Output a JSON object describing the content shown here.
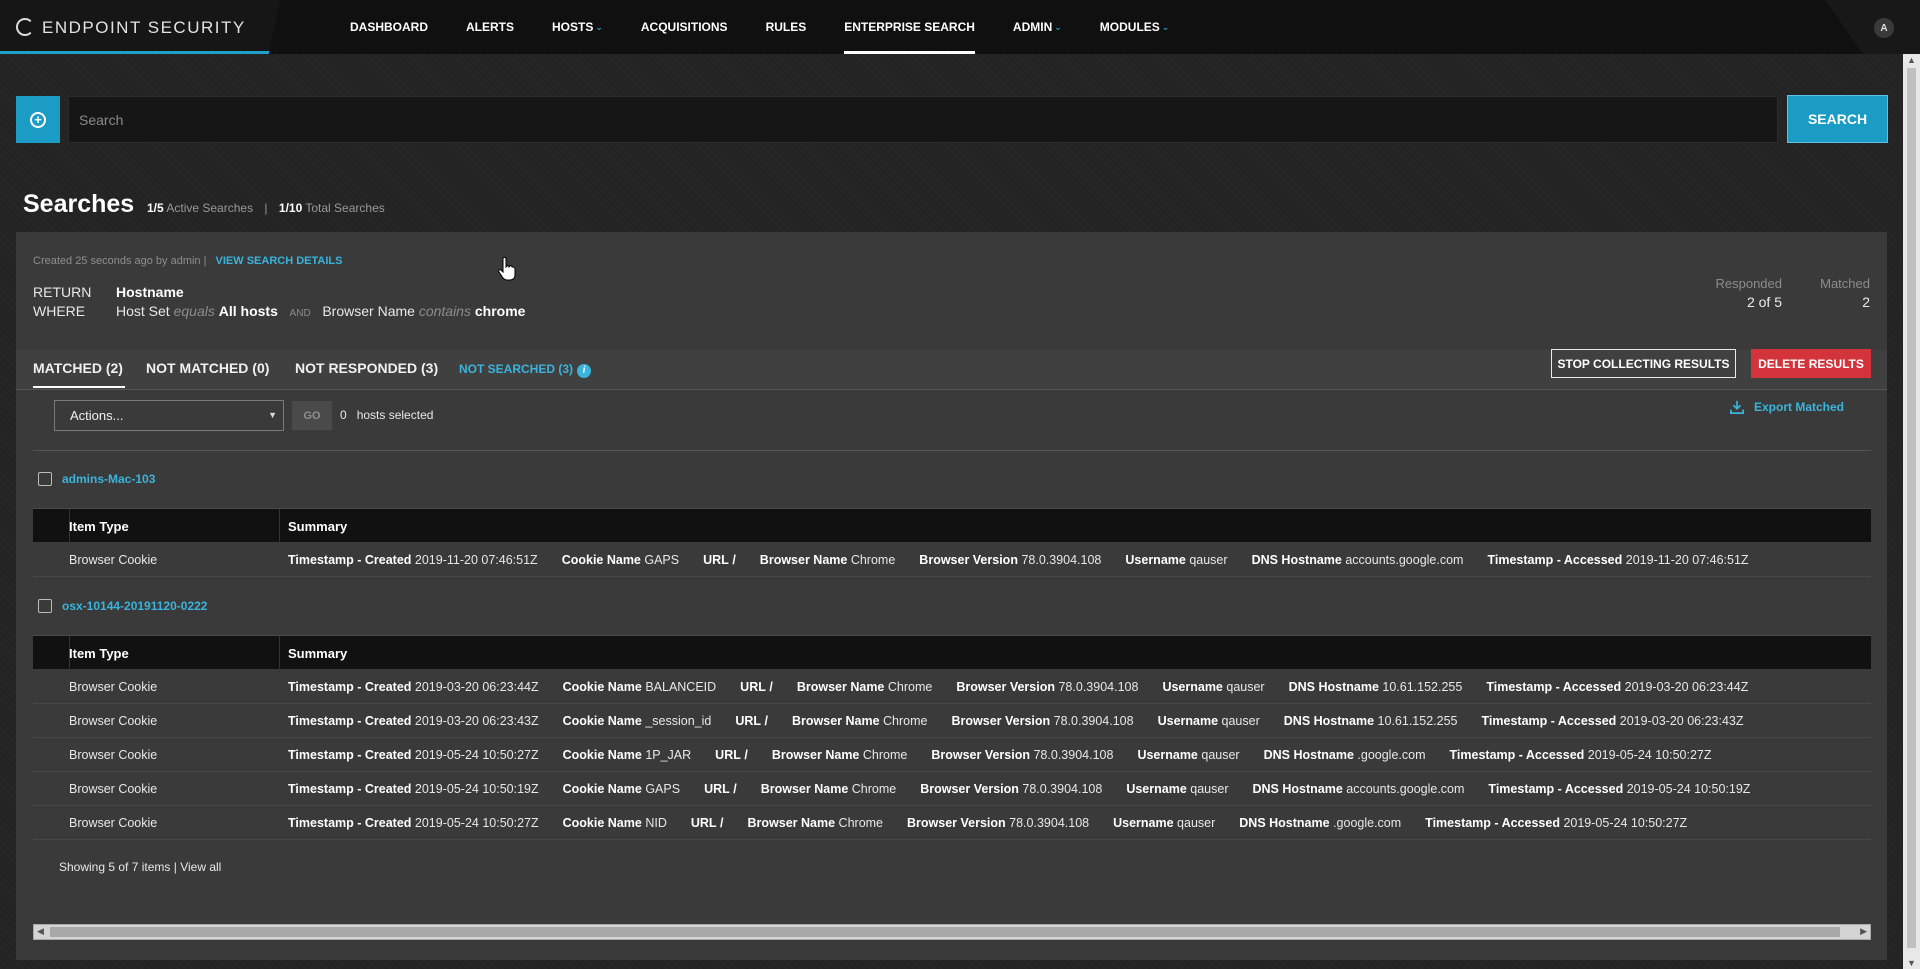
{
  "brand": {
    "title": "ENDPOINT SECURITY"
  },
  "nav": {
    "items": [
      {
        "label": "DASHBOARD"
      },
      {
        "label": "ALERTS"
      },
      {
        "label": "HOSTS",
        "caret": "⌄"
      },
      {
        "label": "ACQUISITIONS"
      },
      {
        "label": "RULES"
      },
      {
        "label": "ENTERPRISE SEARCH"
      },
      {
        "label": "ADMIN",
        "caret": "⌄"
      },
      {
        "label": "MODULES",
        "caret": "⌄"
      }
    ],
    "active": "ENTERPRISE SEARCH"
  },
  "user": {
    "initial": "A"
  },
  "search": {
    "placeholder": "Search",
    "button_label": "SEARCH"
  },
  "page": {
    "title": "Searches",
    "active_count": "1/5",
    "active_label": "Active Searches",
    "sep": "|",
    "total_count": "1/10",
    "total_label": "Total Searches"
  },
  "search_detail": {
    "created": "Created 25 seconds ago by admin  |",
    "view_details": "VIEW SEARCH DETAILS",
    "return_label": "RETURN",
    "return_value": "Hostname",
    "where_label": "WHERE",
    "cond1_field": "Host Set",
    "cond1_op": "equals",
    "cond1_value": "All hosts",
    "and_label": "AND",
    "cond2_field": "Browser Name",
    "cond2_op": "contains",
    "cond2_value": "chrome",
    "responded_label": "Responded",
    "responded_value": "2 of 5",
    "matched_label": "Matched",
    "matched_value": "2"
  },
  "tabs": {
    "matched": "MATCHED (2)",
    "not_matched": "NOT MATCHED (0)",
    "not_responded": "NOT RESPONDED (3)",
    "not_searched": "NOT SEARCHED (3)",
    "info": "i",
    "stop_button": "STOP COLLECTING RESULTS",
    "delete_button": "DELETE RESULTS"
  },
  "actions": {
    "select_value": "Actions...",
    "go_label": "GO",
    "selected_count": "0",
    "selected_label": "hosts selected",
    "export_label": "Export Matched"
  },
  "table_headers": {
    "item_type": "Item Type",
    "summary": "Summary"
  },
  "field_labels": {
    "created": "Timestamp - Created",
    "cookie": "Cookie Name",
    "url": "URL",
    "browser": "Browser Name",
    "version": "Browser Version",
    "username": "Username",
    "dns": "DNS Hostname",
    "accessed": "Timestamp - Accessed"
  },
  "hosts": [
    {
      "name": "admins-Mac-103",
      "rows": [
        {
          "type": "Browser Cookie",
          "created": "2019-11-20 07:46:51Z",
          "cookie": "GAPS",
          "url": "/",
          "browser": "Chrome",
          "version": "78.0.3904.108",
          "username": "qauser",
          "dns": "accounts.google.com",
          "accessed": "2019-11-20 07:46:51Z"
        }
      ]
    },
    {
      "name": "osx-10144-20191120-0222",
      "rows": [
        {
          "type": "Browser Cookie",
          "created": "2019-03-20 06:23:44Z",
          "cookie": "BALANCEID",
          "url": "/",
          "browser": "Chrome",
          "version": "78.0.3904.108",
          "username": "qauser",
          "dns": "10.61.152.255",
          "accessed": "2019-03-20 06:23:44Z"
        },
        {
          "type": "Browser Cookie",
          "created": "2019-03-20 06:23:43Z",
          "cookie": "_session_id",
          "url": "/",
          "browser": "Chrome",
          "version": "78.0.3904.108",
          "username": "qauser",
          "dns": "10.61.152.255",
          "accessed": "2019-03-20 06:23:43Z"
        },
        {
          "type": "Browser Cookie",
          "created": "2019-05-24 10:50:27Z",
          "cookie": "1P_JAR",
          "url": "/",
          "browser": "Chrome",
          "version": "78.0.3904.108",
          "username": "qauser",
          "dns": ".google.com",
          "accessed": "2019-05-24 10:50:27Z"
        },
        {
          "type": "Browser Cookie",
          "created": "2019-05-24 10:50:19Z",
          "cookie": "GAPS",
          "url": "/",
          "browser": "Chrome",
          "version": "78.0.3904.108",
          "username": "qauser",
          "dns": "accounts.google.com",
          "accessed": "2019-05-24 10:50:19Z"
        },
        {
          "type": "Browser Cookie",
          "created": "2019-05-24 10:50:27Z",
          "cookie": "NID",
          "url": "/",
          "browser": "Chrome",
          "version": "78.0.3904.108",
          "username": "qauser",
          "dns": ".google.com",
          "accessed": "2019-05-24 10:50:27Z"
        }
      ]
    }
  ],
  "footer": {
    "showing": "Showing 5 of 7 items |",
    "view_all": "View all"
  }
}
